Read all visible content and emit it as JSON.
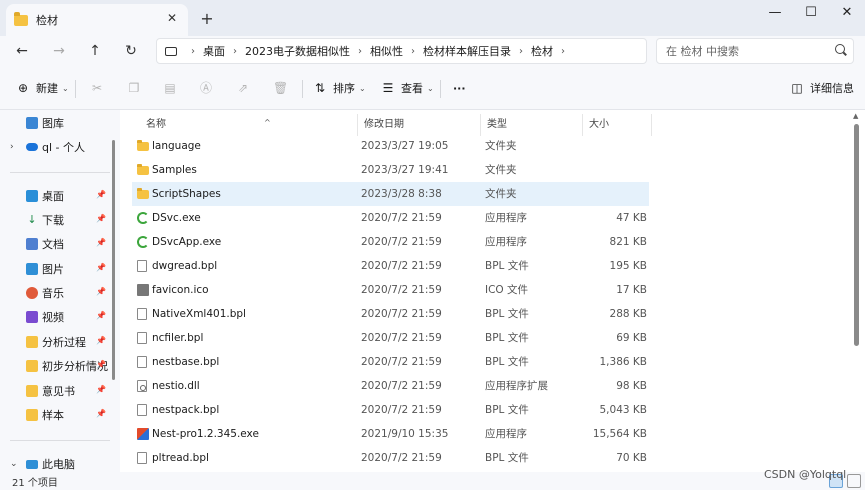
{
  "window": {
    "tab_title": "检材",
    "tab_close": "✕",
    "new_tab": "+",
    "minimize": "—",
    "maximize": "☐",
    "close": "✕"
  },
  "nav": {
    "back": "←",
    "forward": "→",
    "up": "↑",
    "refresh": "↻"
  },
  "breadcrumb": [
    "桌面",
    "2023电子数据相似性",
    "相似性",
    "检材样本解压目录",
    "检材"
  ],
  "search": {
    "placeholder": "在 检材 中搜索"
  },
  "toolbar": {
    "new_label": "新建",
    "sort_label": "排序",
    "view_label": "查看",
    "more_label": "···",
    "details_label": "详细信息"
  },
  "sidebar": {
    "gallery": "图库",
    "onedrive": "ql - 个人",
    "pinned": [
      "桌面",
      "下载",
      "文档",
      "图片",
      "音乐",
      "视频",
      "分析过程",
      "初步分析情况",
      "意见书",
      "样本"
    ],
    "this_pc": "此电脑"
  },
  "columns": {
    "name": "名称",
    "date": "修改日期",
    "type": "类型",
    "size": "大小"
  },
  "files": [
    {
      "name": "language",
      "date": "2023/3/27 19:05",
      "type": "文件夹",
      "size": "",
      "icon": "folder"
    },
    {
      "name": "Samples",
      "date": "2023/3/27 19:41",
      "type": "文件夹",
      "size": "",
      "icon": "folder"
    },
    {
      "name": "ScriptShapes",
      "date": "2023/3/28 8:38",
      "type": "文件夹",
      "size": "",
      "icon": "folder"
    },
    {
      "name": "DSvc.exe",
      "date": "2020/7/2 21:59",
      "type": "应用程序",
      "size": "47 KB",
      "icon": "exe-green"
    },
    {
      "name": "DSvcApp.exe",
      "date": "2020/7/2 21:59",
      "type": "应用程序",
      "size": "821 KB",
      "icon": "exe-green"
    },
    {
      "name": "dwgread.bpl",
      "date": "2020/7/2 21:59",
      "type": "BPL 文件",
      "size": "195 KB",
      "icon": "doc"
    },
    {
      "name": "favicon.ico",
      "date": "2020/7/2 21:59",
      "type": "ICO 文件",
      "size": "17 KB",
      "icon": "ico"
    },
    {
      "name": "NativeXml401.bpl",
      "date": "2020/7/2 21:59",
      "type": "BPL 文件",
      "size": "288 KB",
      "icon": "doc"
    },
    {
      "name": "ncfiler.bpl",
      "date": "2020/7/2 21:59",
      "type": "BPL 文件",
      "size": "69 KB",
      "icon": "doc"
    },
    {
      "name": "nestbase.bpl",
      "date": "2020/7/2 21:59",
      "type": "BPL 文件",
      "size": "1,386 KB",
      "icon": "doc"
    },
    {
      "name": "nestio.dll",
      "date": "2020/7/2 21:59",
      "type": "应用程序扩展",
      "size": "98 KB",
      "icon": "dll"
    },
    {
      "name": "nestpack.bpl",
      "date": "2020/7/2 21:59",
      "type": "BPL 文件",
      "size": "5,043 KB",
      "icon": "doc"
    },
    {
      "name": "Nest-pro1.2.345.exe",
      "date": "2021/9/10 15:35",
      "type": "应用程序",
      "size": "15,564 KB",
      "icon": "nest"
    },
    {
      "name": "pltread.bpl",
      "date": "2020/7/2 21:59",
      "type": "BPL 文件",
      "size": "70 KB",
      "icon": "doc"
    }
  ],
  "selected_index": 2,
  "status": {
    "item_count": "21 个项目"
  },
  "watermark": "CSDN @Yolqtql"
}
